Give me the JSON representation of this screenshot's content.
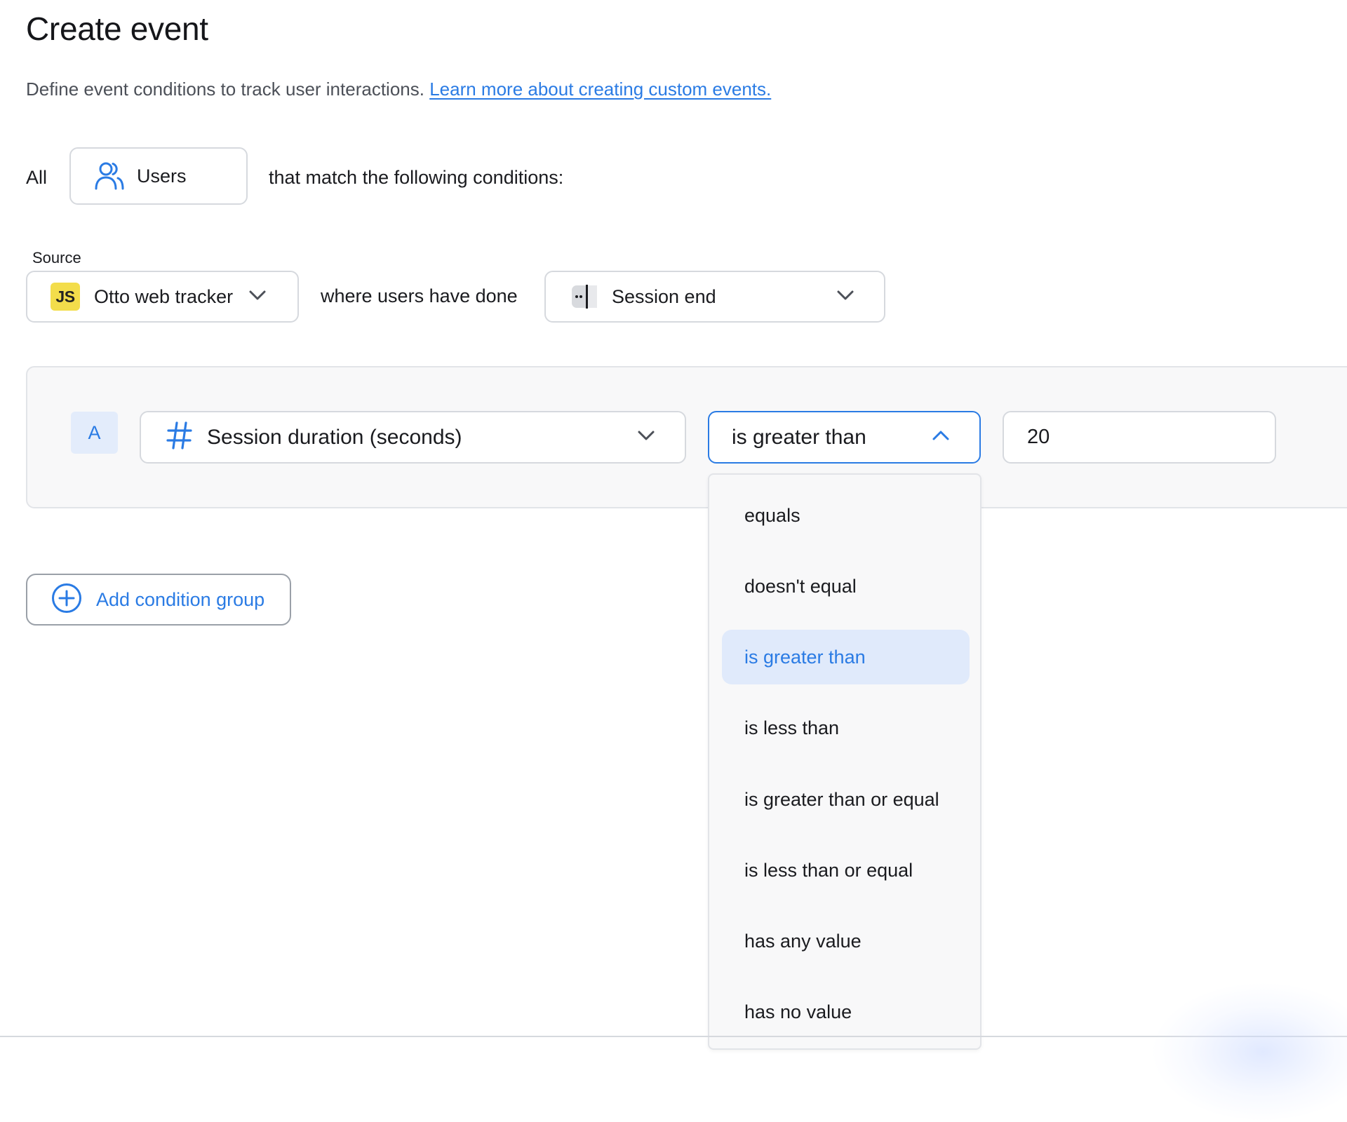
{
  "page": {
    "title": "Create event",
    "subtitle": "Define event conditions to track user interactions.",
    "learn_more": "Learn more about creating custom events."
  },
  "audience": {
    "prefix": "All",
    "entity": "Users",
    "suffix": "that match the following conditions:"
  },
  "source": {
    "label": "Source",
    "badge": "JS",
    "value": "Otto web tracker",
    "connector": "where users have done",
    "event": "Session end"
  },
  "condition": {
    "letter": "A",
    "property": "Session duration (seconds)",
    "operator": "is greater than",
    "value": "20"
  },
  "add_group_label": "Add condition group",
  "operator_options": [
    "equals",
    "doesn't equal",
    "is greater than",
    "is less than",
    "is greater than or equal",
    "is less than or equal",
    "has any value",
    "has no value"
  ],
  "selected_operator": "is greater than",
  "colors": {
    "accent": "#2a7be4",
    "js_badge": "#f3dd4b",
    "selected_option_bg": "#e0eafb"
  }
}
